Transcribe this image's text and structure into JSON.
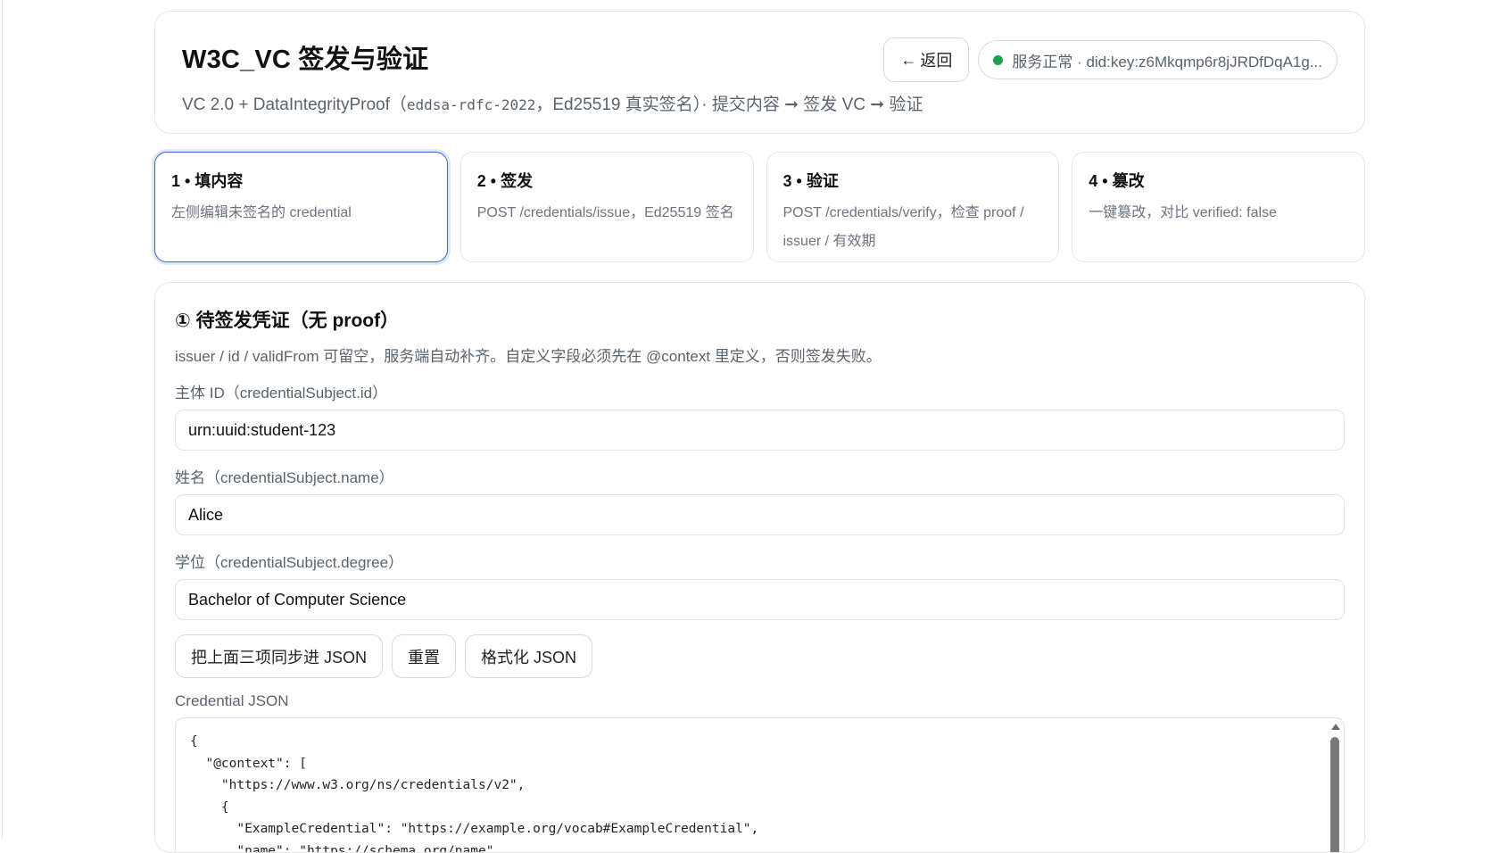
{
  "header": {
    "title": "W3C_VC 签发与验证",
    "subtitle_prefix": "VC 2.0 + DataIntegrityProof（",
    "subtitle_mono": "eddsa-rdfc-2022",
    "subtitle_suffix": "，Ed25519 真实签名）· 提交内容 ➞ 签发 VC ➞ 验证",
    "back_label": "返回",
    "back_arrow": "←",
    "status_text": "服务正常 · did:key:z6Mkqmp6r8jJRDfDqA1g..."
  },
  "steps": [
    {
      "title": "1 • 填内容",
      "desc": "左侧编辑未签名的 credential"
    },
    {
      "title": "2 • 签发",
      "desc": "POST /credentials/issue，Ed25519 签名"
    },
    {
      "title": "3 • 验证",
      "desc": "POST /credentials/verify，检查 proof / issuer / 有效期"
    },
    {
      "title": "4 • 篡改",
      "desc": "一键篡改，对比 verified: false"
    }
  ],
  "form": {
    "title": "① 待签发凭证（无 proof）",
    "hint": "issuer / id / validFrom 可留空，服务端自动补齐。自定义字段必须先在 @context 里定义，否则签发失败。",
    "subject_id_label": "主体 ID（credentialSubject.id）",
    "subject_id_value": "urn:uuid:student-123",
    "name_label": "姓名（credentialSubject.name）",
    "name_value": "Alice",
    "degree_label": "学位（credentialSubject.degree）",
    "degree_value": "Bachelor of Computer Science",
    "sync_button": "把上面三项同步进 JSON",
    "reset_button": "重置",
    "format_button": "格式化 JSON",
    "json_label": "Credential JSON",
    "json_text": "{\n  \"@context\": [\n    \"https://www.w3.org/ns/credentials/v2\",\n    {\n      \"ExampleCredential\": \"https://example.org/vocab#ExampleCredential\",\n      \"name\": \"https://schema.org/name\","
  }
}
